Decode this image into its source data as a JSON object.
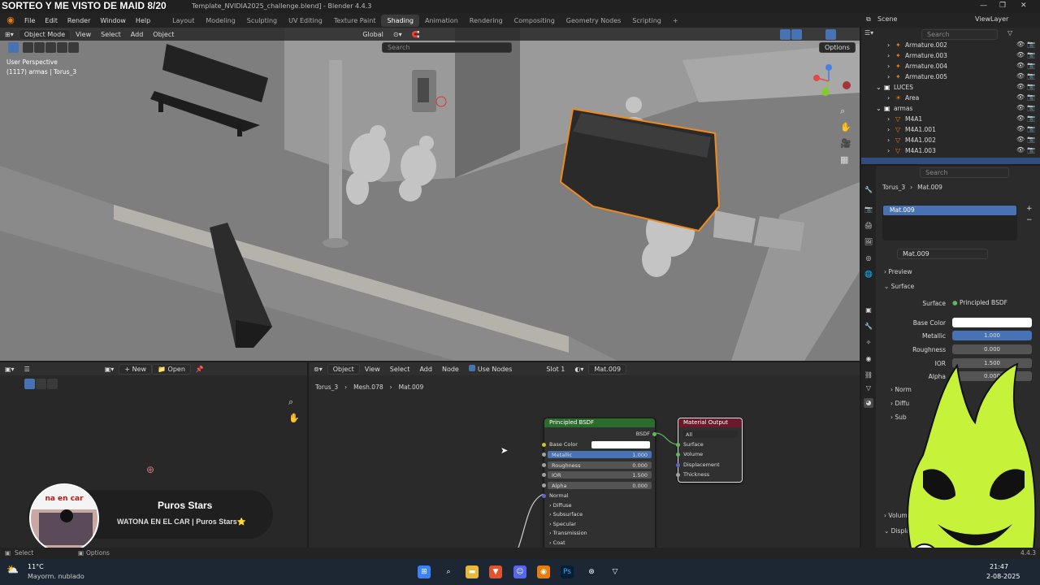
{
  "overlay_title": "SORTEO Y ME VISTO DE MAID 8/20",
  "window": {
    "title": "Template_NVIDIA2025_challenge.blend] - Blender 4.4.3"
  },
  "menu": [
    "File",
    "Edit",
    "Render",
    "Window",
    "Help"
  ],
  "workspaces": [
    "Layout",
    "Modeling",
    "Sculpting",
    "UV Editing",
    "Texture Paint",
    "Shading",
    "Animation",
    "Rendering",
    "Compositing",
    "Geometry Nodes",
    "Scripting"
  ],
  "active_workspace": "Shading",
  "scene_bar": {
    "scene": "Scene",
    "view_layer": "ViewLayer"
  },
  "viewport": {
    "mode": "Object Mode",
    "menus": [
      "View",
      "Select",
      "Add",
      "Object"
    ],
    "orientation": "Global",
    "search_placeholder": "Search",
    "options_label": "Options",
    "view_name": "User Perspective",
    "object_info": "(1117) armas | Torus_3"
  },
  "image_editor": {
    "new_label": "New",
    "open_label": "Open"
  },
  "node_editor": {
    "object_type": "Object",
    "menus": [
      "View",
      "Select",
      "Add",
      "Node"
    ],
    "use_nodes_label": "Use Nodes",
    "slot": "Slot 1",
    "material": "Mat.009",
    "breadcrumb": [
      "Torus_3",
      "Mesh.078",
      "Mat.009"
    ],
    "bsdf_node": {
      "title": "Principled BSDF",
      "output": "BSDF",
      "base_color_label": "Base Color",
      "fields": [
        {
          "label": "Metallic",
          "value": "1.000"
        },
        {
          "label": "Roughness",
          "value": "0.000"
        },
        {
          "label": "IOR",
          "value": "1.500"
        },
        {
          "label": "Alpha",
          "value": "0.000"
        }
      ],
      "normal_label": "Normal",
      "panels": [
        "Diffuse",
        "Subsurface",
        "Specular",
        "Transmission",
        "Coat"
      ]
    },
    "output_node": {
      "title": "Material Output",
      "target": "All",
      "inputs": [
        "Surface",
        "Volume",
        "Displacement",
        "Thickness"
      ]
    }
  },
  "outliner": {
    "search_placeholder": "Search",
    "rows": [
      {
        "label": "Armature.002",
        "indent": 0
      },
      {
        "label": "Armature.003",
        "indent": 0
      },
      {
        "label": "Armature.004",
        "indent": 0
      },
      {
        "label": "Armature.005",
        "indent": 0
      },
      {
        "label": "LUCES",
        "indent": -1
      },
      {
        "label": "Area",
        "indent": 0
      },
      {
        "label": "armas",
        "indent": -1
      },
      {
        "label": "M4A1",
        "indent": 0
      },
      {
        "label": "M4A1.001",
        "indent": 0
      },
      {
        "label": "M4A1.002",
        "indent": 0
      },
      {
        "label": "M4A1.003",
        "indent": 0
      }
    ]
  },
  "properties": {
    "search_placeholder": "Search",
    "object": "Torus_3",
    "material": "Mat.009",
    "slot_item": "Mat.009",
    "material_field": "Mat.009",
    "preview_label": "Preview",
    "surface_label": "Surface",
    "surface_shader": "Principled BSDF",
    "base_color_label": "Base Color",
    "fields": [
      {
        "label": "Metallic",
        "value": "1.000"
      },
      {
        "label": "Roughness",
        "value": "0.000"
      },
      {
        "label": "IOR",
        "value": "1.500"
      },
      {
        "label": "Alpha",
        "value": "0.000"
      }
    ],
    "collapsed": [
      "Norm",
      "Diffu",
      "Sub"
    ],
    "volume_label": "Volum",
    "displacement_label": "Displacement"
  },
  "status": {
    "select": "Select",
    "options": "Options",
    "version": "4.4.3"
  },
  "weather": {
    "temp": "11°C",
    "desc": "Mayorm. nublado"
  },
  "clock": {
    "time": "21:47",
    "date": "2-08-2025"
  },
  "stream_card": {
    "name": "Puros Stars",
    "subtitle": "WATONA EN EL CAR | Puros Stars⭐",
    "avatar_text": "na en car"
  },
  "colors": {
    "accent": "#4772b3",
    "orange": "#e87d0d",
    "bsdf_header": "#2b6b2b",
    "output_header": "#6b1a2b",
    "mascot": "#c6f33a"
  }
}
